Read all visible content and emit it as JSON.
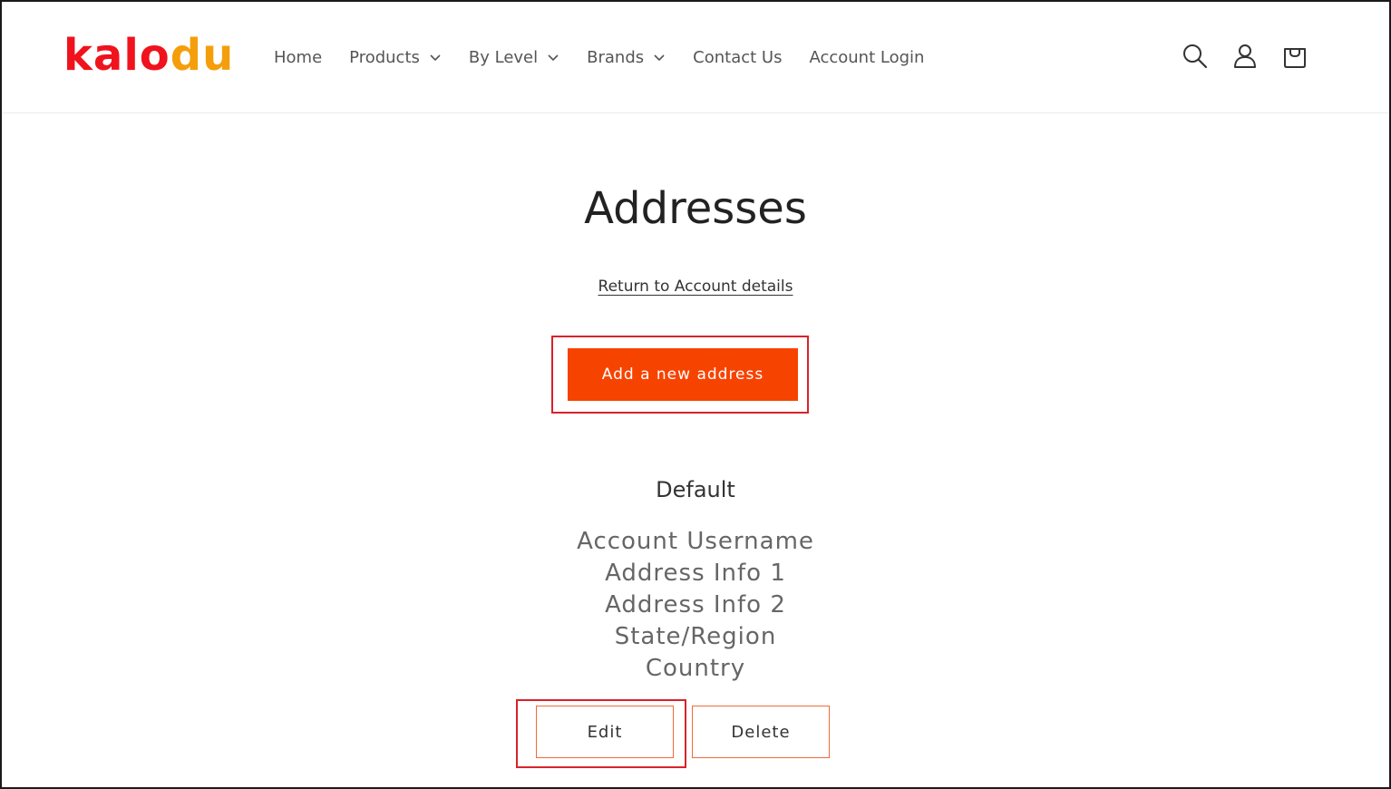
{
  "logo": {
    "part1": "kalo",
    "part2": "du"
  },
  "nav": {
    "items": [
      {
        "label": "Home",
        "dropdown": false
      },
      {
        "label": "Products",
        "dropdown": true
      },
      {
        "label": "By Level",
        "dropdown": true
      },
      {
        "label": "Brands",
        "dropdown": true
      },
      {
        "label": "Contact Us",
        "dropdown": false
      },
      {
        "label": "Account Login",
        "dropdown": false
      }
    ]
  },
  "header_icons": [
    "search-icon",
    "account-icon",
    "cart-icon"
  ],
  "main": {
    "title": "Addresses",
    "return_link": "Return to Account details",
    "add_button": "Add a new address",
    "default_heading": "Default",
    "address_lines": [
      "Account Username",
      "Address Info 1",
      "Address Info 2",
      "State/Region",
      "Country"
    ],
    "edit_button": "Edit",
    "delete_button": "Delete"
  },
  "colors": {
    "brand_red": "#f0121d",
    "brand_orange": "#f59e0b",
    "primary_button": "#f74300",
    "highlight_box": "#d8232a"
  }
}
